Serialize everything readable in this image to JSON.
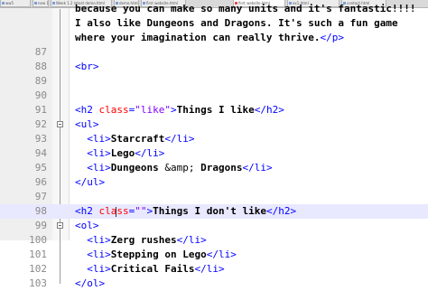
{
  "tabs": [
    {
      "label": "ww5"
    },
    {
      "label": "new 1.3 latest demo.html"
    },
    {
      "label": "Week 1.2 latest demo.html"
    },
    {
      "label": "demo.html"
    },
    {
      "label": "first website.html"
    },
    {
      "label": "first website.html"
    },
    {
      "label": "ex1.html"
    },
    {
      "label": "contact.html"
    }
  ],
  "lines": [
    {
      "num": "",
      "parts": [
        {
          "t": "because you can make so many units and it's fantastic!!!!",
          "c": "text"
        }
      ]
    },
    {
      "num": "",
      "parts": [
        {
          "t": "I also like Dungeons and Dragons. It's such a fun game",
          "c": "text"
        }
      ]
    },
    {
      "num": "",
      "parts": [
        {
          "t": "where your imagination can really thrive.",
          "c": "text"
        },
        {
          "t": "</p>",
          "c": "tag"
        }
      ]
    },
    {
      "num": "87",
      "parts": []
    },
    {
      "num": "88",
      "parts": [
        {
          "t": "<br>",
          "c": "tag"
        }
      ]
    },
    {
      "num": "89",
      "parts": []
    },
    {
      "num": "90",
      "parts": []
    },
    {
      "num": "91",
      "parts": [
        {
          "t": "<h2 ",
          "c": "tag"
        },
        {
          "t": "class",
          "c": "attr"
        },
        {
          "t": "=",
          "c": "tag"
        },
        {
          "t": "\"like\"",
          "c": "val"
        },
        {
          "t": ">",
          "c": "tag"
        },
        {
          "t": "Things I like",
          "c": "text"
        },
        {
          "t": "</h2>",
          "c": "tag"
        }
      ]
    },
    {
      "num": "92",
      "parts": [
        {
          "t": "<ul>",
          "c": "tag"
        }
      ]
    },
    {
      "num": "93",
      "parts": [
        {
          "t": "  ",
          "c": "text"
        },
        {
          "t": "<li>",
          "c": "tag"
        },
        {
          "t": "Starcraft",
          "c": "text"
        },
        {
          "t": "</li>",
          "c": "tag"
        }
      ]
    },
    {
      "num": "94",
      "parts": [
        {
          "t": "  ",
          "c": "text"
        },
        {
          "t": "<li>",
          "c": "tag"
        },
        {
          "t": "Lego",
          "c": "text"
        },
        {
          "t": "</li>",
          "c": "tag"
        }
      ]
    },
    {
      "num": "95",
      "parts": [
        {
          "t": "  ",
          "c": "text"
        },
        {
          "t": "<li>",
          "c": "tag"
        },
        {
          "t": "Dungeons ",
          "c": "text"
        },
        {
          "t": "&amp;",
          "c": "ent"
        },
        {
          "t": " Dragons",
          "c": "text"
        },
        {
          "t": "</li>",
          "c": "tag"
        }
      ]
    },
    {
      "num": "96",
      "parts": [
        {
          "t": "</ul>",
          "c": "tag"
        }
      ]
    },
    {
      "num": "97",
      "parts": []
    },
    {
      "num": "98",
      "parts": [
        {
          "t": "<h2 ",
          "c": "tag"
        },
        {
          "t": "class",
          "c": "attr"
        },
        {
          "t": "=",
          "c": "tag"
        },
        {
          "t": "\"\"",
          "c": "val"
        },
        {
          "t": ">",
          "c": "tag"
        },
        {
          "t": "Things I don't like",
          "c": "text"
        },
        {
          "t": "</h2>",
          "c": "tag"
        }
      ],
      "current": true
    },
    {
      "num": "99",
      "parts": [
        {
          "t": "<ol>",
          "c": "tag"
        }
      ]
    },
    {
      "num": "100",
      "parts": [
        {
          "t": "  ",
          "c": "text"
        },
        {
          "t": "<li>",
          "c": "tag"
        },
        {
          "t": "Zerg rushes",
          "c": "text"
        },
        {
          "t": "</li>",
          "c": "tag"
        }
      ]
    },
    {
      "num": "101",
      "parts": [
        {
          "t": "  ",
          "c": "text"
        },
        {
          "t": "<li>",
          "c": "tag"
        },
        {
          "t": "Stepping on Lego",
          "c": "text"
        },
        {
          "t": "</li>",
          "c": "tag"
        }
      ]
    },
    {
      "num": "102",
      "parts": [
        {
          "t": "  ",
          "c": "text"
        },
        {
          "t": "<li>",
          "c": "tag"
        },
        {
          "t": "Critical Fails",
          "c": "text"
        },
        {
          "t": "</li>",
          "c": "tag"
        }
      ]
    },
    {
      "num": "103",
      "parts": [
        {
          "t": "</ol>",
          "c": "tag"
        }
      ]
    }
  ],
  "colors": {
    "tag": "#0000ff",
    "attr": "#ff0000",
    "value": "#8000ff",
    "text": "#000000",
    "current_line": "#e8e8ff"
  }
}
